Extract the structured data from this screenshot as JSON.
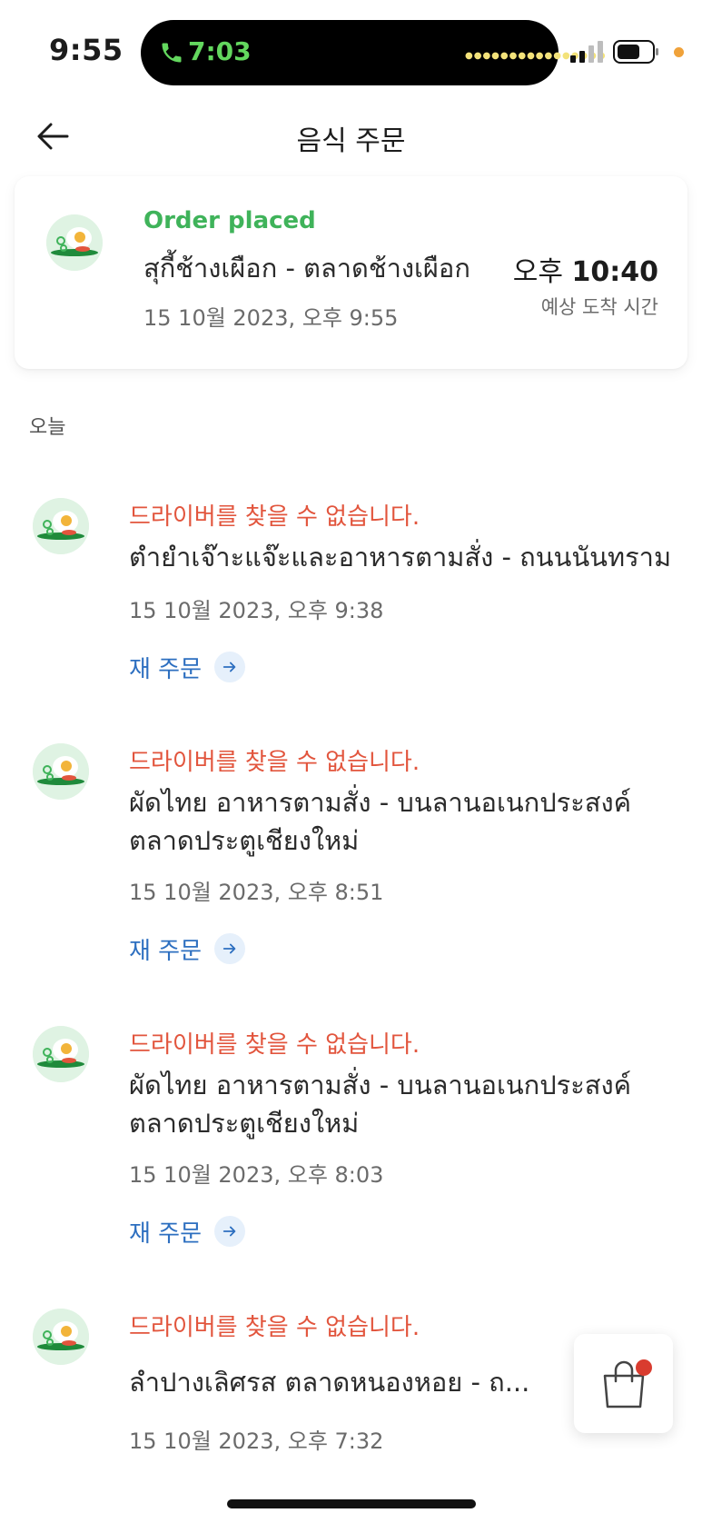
{
  "status_bar": {
    "clock": "9:55",
    "call_time": "7:03",
    "accent_call": "#63d75e"
  },
  "header": {
    "title": "음식 주문",
    "back_icon": "arrow-left-icon"
  },
  "active_order": {
    "status": "Order placed",
    "store": "สุกี้ช้างเผือก - ตลาดช้างเผือก",
    "date": "15 10월 2023, 오후 9:55",
    "eta_prefix": "오후",
    "eta_time": "10:40",
    "eta_label": "예상 도착 시간",
    "status_color": "#3fb35a"
  },
  "section_label": "오늘",
  "orders": [
    {
      "status": "드라이버를 찾을 수 없습니다.",
      "store": "ตำยำเจ๊าะแจ๊ะและอาหารตามสั่ง - ถนนนันทราม",
      "date": "15 10월 2023, 오후 9:38",
      "reorder": "재 주문"
    },
    {
      "status": "드라이버를 찾을 수 없습니다.",
      "store": "ผัดไทย อาหารตามสั่ง - บนลานอเนกประสงค์ ตลาดประตูเชียงใหม่",
      "date": "15 10월 2023, 오후 8:51",
      "reorder": "재 주문"
    },
    {
      "status": "드라이버를 찾을 수 없습니다.",
      "store": "ผัดไทย อาหารตามสั่ง - บนลานอเนกประสงค์ ตลาดประตูเชียงใหม่",
      "date": "15 10월 2023, 오후 8:03",
      "reorder": "재 주문"
    },
    {
      "status": "드라이버를 찾을 수 없습니다.",
      "store": "ลำปางเลิศรส ตลาดหนองหอย - ถ...",
      "date": "15 10월 2023, 오후 7:32"
    }
  ],
  "colors": {
    "error": "#e2553d",
    "link": "#2d6fc0",
    "cart_badge": "#d93c2f"
  },
  "icons": {
    "food": "fried-egg-plate-icon",
    "cart": "shopping-bag-icon",
    "reorder": "arrow-right-icon"
  }
}
